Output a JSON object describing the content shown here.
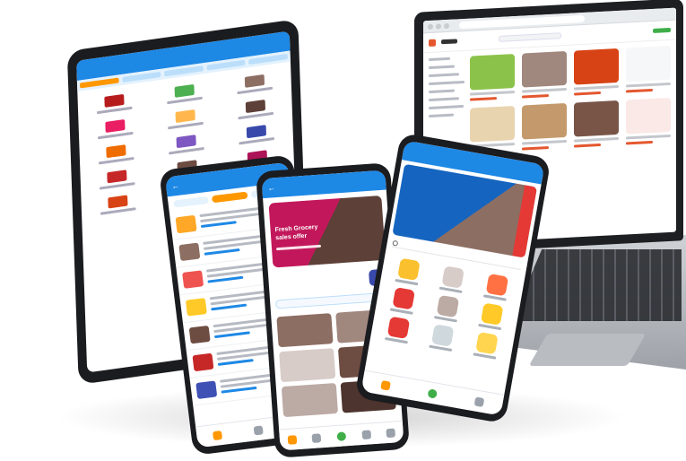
{
  "scene": {
    "colors": {
      "app_primary": "#1e88e5",
      "accent_orange": "#ff9800",
      "brand_red": "#e4572e",
      "nav_green": "#3fae49",
      "device_bezel": "#1b1c1f"
    }
  },
  "laptop": {
    "product_colors": [
      "#8bc34a",
      "#a1887f",
      "#d84315",
      "#f6f7f9",
      "#e9d4b0",
      "#c49a6c",
      "#795548",
      "#fbe9e7"
    ]
  },
  "tablet": {
    "item_colors": [
      "#b71c1c",
      "#4caf50",
      "#8d6e63",
      "#e91e63",
      "#ffb74d",
      "#5d4037",
      "#ef6c00",
      "#7e57c2",
      "#3949ab",
      "#c62828",
      "#6d4c41",
      "#ad1457",
      "#d84315",
      "#fbc02d",
      "#5e35b1"
    ]
  },
  "phone_list": {
    "row_colors": [
      "#ffa726",
      "#8d6e63",
      "#ef5350",
      "#ffca28",
      "#6d4c41",
      "#c62828",
      "#3f51b5"
    ]
  },
  "phone_home": {
    "banner_text": "Fresh Grocery\nsales offer"
  },
  "phone_categories": {
    "category_colors": [
      "#fbc02d",
      "#d7ccc8",
      "#ff7043",
      "#e53935",
      "#bcaaa4",
      "#ffca28",
      "#e53935",
      "#cfd8dc",
      "#ffd54f"
    ]
  }
}
